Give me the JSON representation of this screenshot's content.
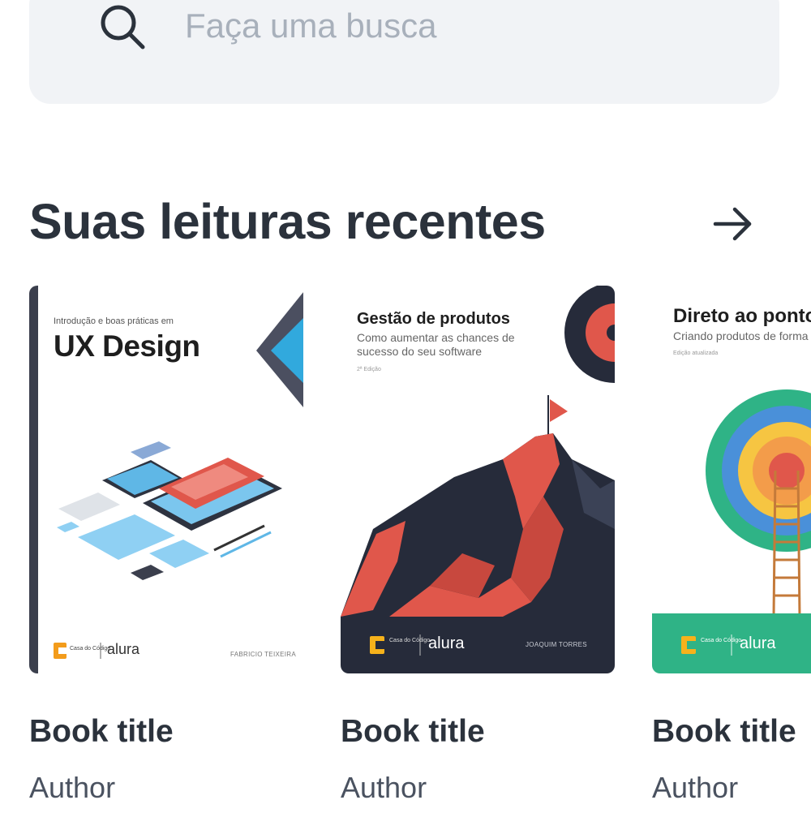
{
  "search": {
    "placeholder": "Faça uma busca",
    "icon": "search-icon"
  },
  "section": {
    "title": "Suas leituras recentes",
    "see_all_icon": "arrow-right-icon"
  },
  "books": [
    {
      "title": "Book title",
      "author": "Author",
      "cover": {
        "series": "Introdução e boas práticas em",
        "heading": "UX Design",
        "publisher": "Casa do Código",
        "partner": "alura",
        "author": "FABRICIO TEIXEIRA"
      }
    },
    {
      "title": "Book title",
      "author": "Author",
      "cover": {
        "heading": "Gestão de produtos",
        "subtitle": "Como aumentar as chances de sucesso do seu software",
        "edition": "2ª Edição",
        "publisher": "Casa do Código",
        "partner": "alura",
        "author": "JOAQUIM TORRES"
      }
    },
    {
      "title": "Book title",
      "author": "Author",
      "cover": {
        "heading": "Direto ao ponto",
        "subtitle": "Criando produtos de forma enxuta",
        "edition": "Edição atualizada",
        "publisher": "Casa do Código",
        "partner": "alura"
      }
    }
  ],
  "colors": {
    "search_bg": "#f1f3f6",
    "text_primary": "#2b323c",
    "placeholder": "#a8b0bb",
    "cover2_footer": "#262b3a",
    "cover3_footer": "#2fb386",
    "accent_red": "#e0574b"
  }
}
